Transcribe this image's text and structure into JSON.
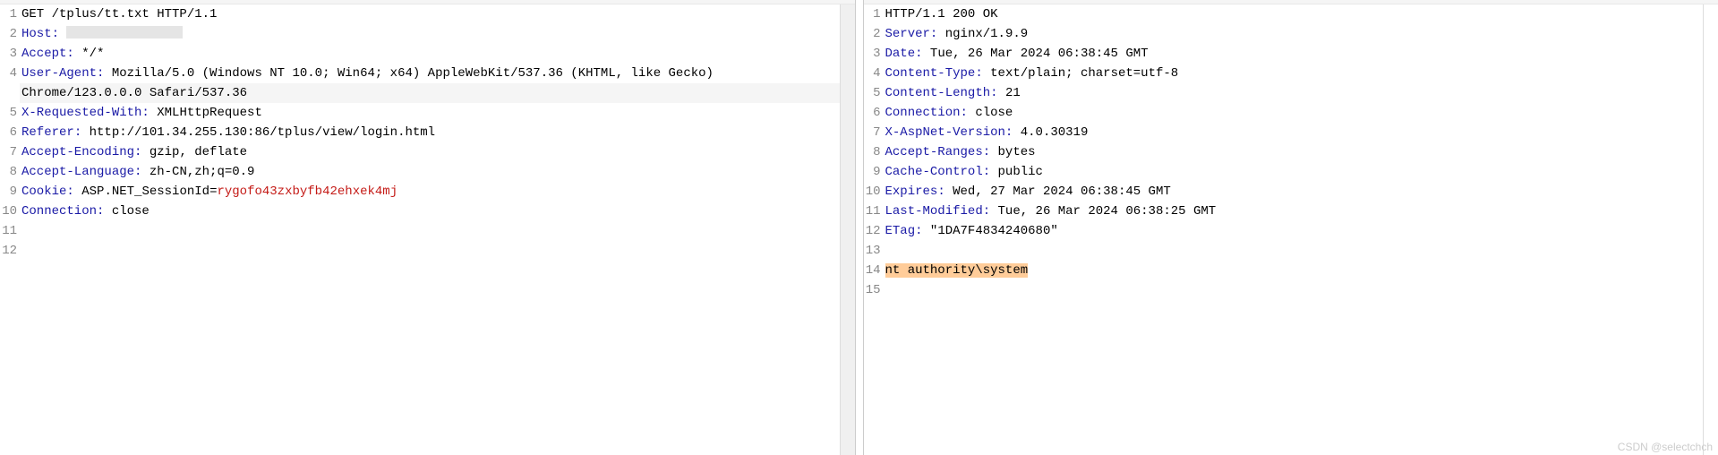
{
  "request": {
    "startLine": {
      "method": "GET",
      "path": "/tplus/tt.txt",
      "protocol": "HTTP/1.1"
    },
    "headers": [
      {
        "key": "Host",
        "value": "",
        "redacted": true
      },
      {
        "key": "Accept",
        "value": "*/*"
      },
      {
        "key": "User-Agent",
        "value": "Mozilla/5.0 (Windows NT 10.0; Win64; x64) AppleWebKit/537.36 (KHTML, like Gecko) Chrome/123.0.0.0 Safari/537.36"
      },
      {
        "key": "X-Requested-With",
        "value": "XMLHttpRequest"
      },
      {
        "key": "Referer",
        "value": "http://101.34.255.130:86/tplus/view/login.html"
      },
      {
        "key": "Accept-Encoding",
        "value": "gzip, deflate"
      },
      {
        "key": "Accept-Language",
        "value": "zh-CN,zh;q=0.9"
      },
      {
        "key": "Cookie",
        "cookieName": "ASP.NET_SessionId",
        "cookieValue": "rygofo43zxbyfb42ehxek4mj"
      },
      {
        "key": "Connection",
        "value": "close"
      }
    ],
    "gutterLines": [
      "1",
      "2",
      "3",
      "4",
      "",
      "5",
      "6",
      "7",
      "8",
      "9",
      "10",
      "11",
      "12"
    ]
  },
  "response": {
    "startLine": {
      "protocol": "HTTP/1.1",
      "status": "200",
      "reason": "OK"
    },
    "headers": [
      {
        "key": "Server",
        "value": "nginx/1.9.9"
      },
      {
        "key": "Date",
        "value": "Tue, 26 Mar 2024 06:38:45 GMT"
      },
      {
        "key": "Content-Type",
        "value": "text/plain; charset=utf-8"
      },
      {
        "key": "Content-Length",
        "value": "21"
      },
      {
        "key": "Connection",
        "value": "close"
      },
      {
        "key": "X-AspNet-Version",
        "value": "4.0.30319"
      },
      {
        "key": "Accept-Ranges",
        "value": "bytes"
      },
      {
        "key": "Cache-Control",
        "value": "public"
      },
      {
        "key": "Expires",
        "value": "Wed, 27 Mar 2024 06:38:45 GMT"
      },
      {
        "key": "Last-Modified",
        "value": "Tue, 26 Mar 2024 06:38:25 GMT"
      },
      {
        "key": "ETag",
        "value": "\"1DA7F4834240680\""
      }
    ],
    "body": [
      {
        "text": ""
      },
      {
        "text": "nt authority\\system",
        "highlighted": true
      }
    ],
    "gutterLines": [
      "1",
      "2",
      "3",
      "4",
      "5",
      "6",
      "7",
      "8",
      "9",
      "10",
      "11",
      "12",
      "13",
      "14",
      "15"
    ]
  },
  "watermark": "CSDN @selectchch"
}
